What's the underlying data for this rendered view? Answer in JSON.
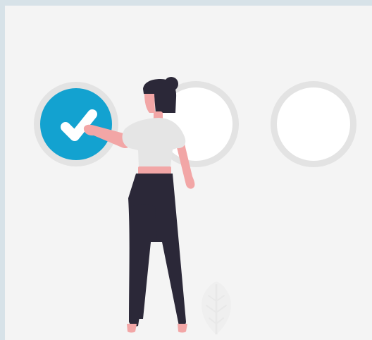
{
  "illustration": {
    "kind": "task-completion illustration",
    "steps": [
      {
        "state": "completed",
        "icon": "check-icon"
      },
      {
        "state": "empty"
      },
      {
        "state": "empty"
      }
    ],
    "colors": {
      "frame": "#d7e2e8",
      "background": "#f4f4f4",
      "ring": "#e3e3e3",
      "accent": "#13a2d0",
      "check": "#ffffff",
      "skin": "#f2a6a6",
      "hair_and_pants": "#2b2838",
      "shirt": "#e5e5e5",
      "plant": "#eeeeee"
    }
  }
}
